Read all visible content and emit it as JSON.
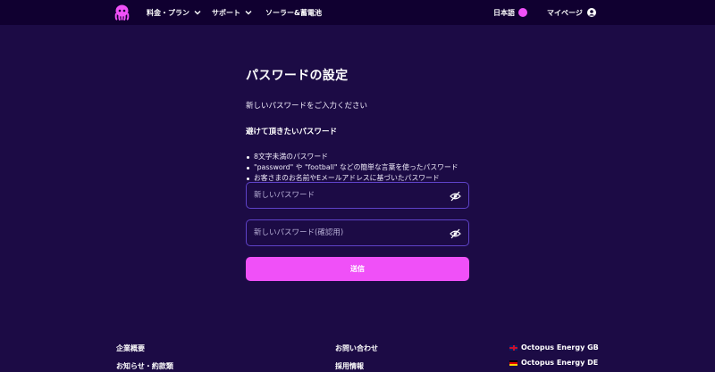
{
  "header": {
    "nav": {
      "plan": "料金・プラン",
      "support": "サポート",
      "solar": "ソーラー&蓄電池",
      "language": "日本語",
      "mypage": "マイページ"
    }
  },
  "main": {
    "title": "パスワードの設定",
    "subtitle": "新しいパスワードをご入力ください",
    "avoid_heading": "避けて頂きたいパスワード",
    "rules": [
      "8文字未満のパスワード",
      "\"password\" や \"football\" などの簡単な言葉を使ったパスワード",
      "お客さまのお名前やEメールアドレスに基づいたパスワード"
    ],
    "new_password": {
      "placeholder": "新しいパスワード",
      "value": ""
    },
    "confirm_password": {
      "placeholder": "新しいパスワード(確認用)",
      "value": ""
    },
    "submit_label": "送信"
  },
  "footer": {
    "company": "企業概要",
    "news": "お知らせ・約款類",
    "contact": "お問い合わせ",
    "careers": "採用情報",
    "octopus_gb": "Octopus Energy GB",
    "octopus_de": "Octopus Energy DE"
  },
  "colors": {
    "background": "#1c0b45",
    "header": "#100030",
    "accent": "#f050f8",
    "field_border": "#5e42c8"
  }
}
